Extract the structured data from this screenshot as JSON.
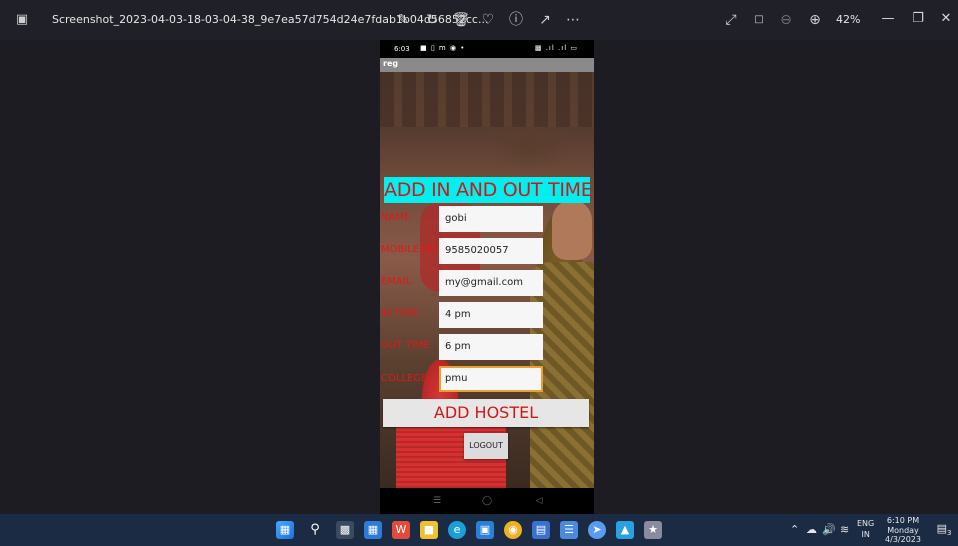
{
  "window": {
    "filename": "Screenshot_2023-04-03-18-03-04-38_9e7ea57d754d24e7fdab1b04d56852cc...",
    "zoom_level": "42%",
    "toolbar_icons": [
      "edit-image-icon",
      "rotate-icon",
      "delete-icon",
      "heart-icon",
      "info-icon",
      "share-icon",
      "more-icon"
    ],
    "view_icons": [
      "expand-icon",
      "actual-size-icon",
      "zoom-out-icon",
      "zoom-in-icon"
    ]
  },
  "phone": {
    "status_time": "6:03",
    "action_bar_title": "reg",
    "heading": "ADD IN AND OUT TIME",
    "fields": [
      {
        "label": "NAME",
        "value": "gobi"
      },
      {
        "label": "MOBILE NO",
        "value": "9585020057"
      },
      {
        "label": "EMAIL",
        "value": "my@gmail.com"
      },
      {
        "label": "IN TIME",
        "value": "4 pm"
      },
      {
        "label": "OUT TIME",
        "value": "6 pm"
      },
      {
        "label": "COLLEGE",
        "value": "pmu"
      }
    ],
    "add_button": "ADD HOSTEL",
    "logout_button": "LOGOUT"
  },
  "taskbar": {
    "language": "ENG",
    "region": "IN",
    "time": "6:10 PM",
    "day": "Monday",
    "date": "4/3/2023",
    "notification_count": "3"
  },
  "colors": {
    "heading_bg": "#00f0f0",
    "label_red": "#e01818",
    "active_border": "#e8a030",
    "taskbar_bg": "#1b2b44"
  }
}
